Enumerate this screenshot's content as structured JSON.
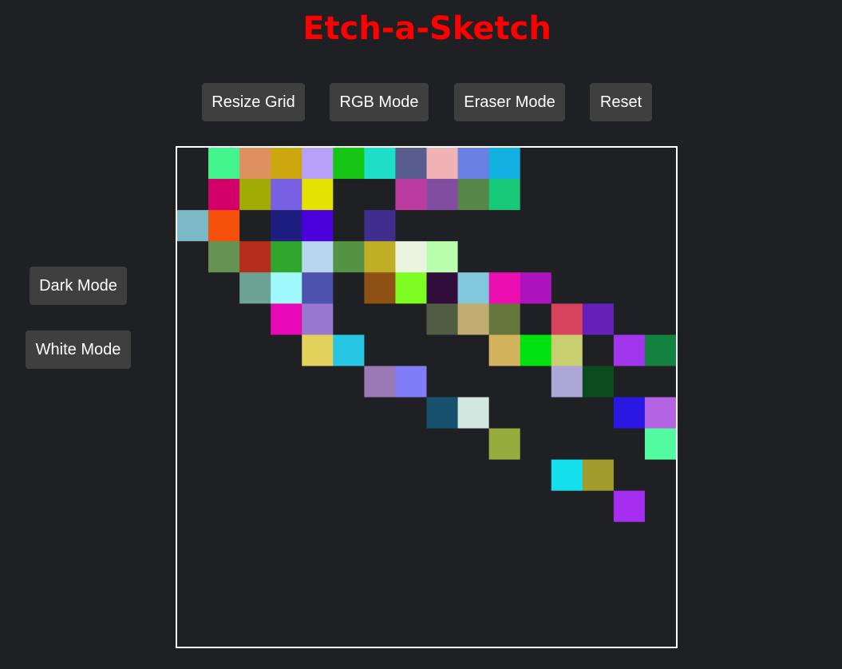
{
  "app": {
    "title": "Etch-a-Sketch",
    "title_color": "#ff0000",
    "background_color": "#1f2023"
  },
  "toolbar": {
    "resize_label": "Resize Grid",
    "rgb_label": "RGB Mode",
    "eraser_label": "Eraser Mode",
    "reset_label": "Reset"
  },
  "side_panel": {
    "dark_label": "Dark Mode",
    "white_label": "White Mode"
  },
  "grid": {
    "columns": 16,
    "rows": 16,
    "border_color": "#ffffff",
    "empty_color": "#1f2023",
    "painted_cells": [
      {
        "row": 0,
        "col": 1,
        "color": "#42f58d"
      },
      {
        "row": 0,
        "col": 2,
        "color": "#de9060"
      },
      {
        "row": 0,
        "col": 3,
        "color": "#cca70f"
      },
      {
        "row": 0,
        "col": 4,
        "color": "#b8a1fb"
      },
      {
        "row": 0,
        "col": 5,
        "color": "#15c614"
      },
      {
        "row": 0,
        "col": 6,
        "color": "#1ddec6"
      },
      {
        "row": 0,
        "col": 7,
        "color": "#595c8e"
      },
      {
        "row": 0,
        "col": 8,
        "color": "#f0b2b5"
      },
      {
        "row": 0,
        "col": 9,
        "color": "#6a80e2"
      },
      {
        "row": 0,
        "col": 10,
        "color": "#12b1e1"
      },
      {
        "row": 1,
        "col": 1,
        "color": "#d30069"
      },
      {
        "row": 1,
        "col": 2,
        "color": "#a0ab03"
      },
      {
        "row": 1,
        "col": 3,
        "color": "#7961e4"
      },
      {
        "row": 1,
        "col": 4,
        "color": "#e3e200"
      },
      {
        "row": 1,
        "col": 7,
        "color": "#bc3ba1"
      },
      {
        "row": 1,
        "col": 8,
        "color": "#814da1"
      },
      {
        "row": 1,
        "col": 9,
        "color": "#568748"
      },
      {
        "row": 1,
        "col": 10,
        "color": "#19c97a"
      },
      {
        "row": 2,
        "col": 0,
        "color": "#7ab9c5"
      },
      {
        "row": 2,
        "col": 1,
        "color": "#f5510a"
      },
      {
        "row": 2,
        "col": 3,
        "color": "#1d1e80"
      },
      {
        "row": 2,
        "col": 4,
        "color": "#4b00dc"
      },
      {
        "row": 2,
        "col": 6,
        "color": "#3f2e8d"
      },
      {
        "row": 3,
        "col": 1,
        "color": "#659352"
      },
      {
        "row": 3,
        "col": 2,
        "color": "#b72d1c"
      },
      {
        "row": 3,
        "col": 3,
        "color": "#2ea52b"
      },
      {
        "row": 3,
        "col": 4,
        "color": "#b6d5ef"
      },
      {
        "row": 3,
        "col": 5,
        "color": "#539343"
      },
      {
        "row": 3,
        "col": 6,
        "color": "#bfae26"
      },
      {
        "row": 3,
        "col": 7,
        "color": "#ebf4e0"
      },
      {
        "row": 3,
        "col": 8,
        "color": "#b9fead"
      },
      {
        "row": 4,
        "col": 2,
        "color": "#6ca394"
      },
      {
        "row": 4,
        "col": 3,
        "color": "#a0f9fd"
      },
      {
        "row": 4,
        "col": 4,
        "color": "#4d52ae"
      },
      {
        "row": 4,
        "col": 6,
        "color": "#8e5314"
      },
      {
        "row": 4,
        "col": 7,
        "color": "#7dfd21"
      },
      {
        "row": 4,
        "col": 8,
        "color": "#300d3b"
      },
      {
        "row": 4,
        "col": 9,
        "color": "#82c8dd"
      },
      {
        "row": 4,
        "col": 10,
        "color": "#eb0fb2"
      },
      {
        "row": 4,
        "col": 11,
        "color": "#ad12bf"
      },
      {
        "row": 5,
        "col": 3,
        "color": "#e709b6"
      },
      {
        "row": 5,
        "col": 4,
        "color": "#9878ce"
      },
      {
        "row": 5,
        "col": 8,
        "color": "#4f5c42"
      },
      {
        "row": 5,
        "col": 9,
        "color": "#c1ad71"
      },
      {
        "row": 5,
        "col": 10,
        "color": "#66773e"
      },
      {
        "row": 5,
        "col": 12,
        "color": "#d5435d"
      },
      {
        "row": 5,
        "col": 13,
        "color": "#6520b8"
      },
      {
        "row": 6,
        "col": 4,
        "color": "#e2d15a"
      },
      {
        "row": 6,
        "col": 5,
        "color": "#27c6e5"
      },
      {
        "row": 6,
        "col": 10,
        "color": "#d4b35f"
      },
      {
        "row": 6,
        "col": 11,
        "color": "#00e210"
      },
      {
        "row": 6,
        "col": 12,
        "color": "#c9cf6e"
      },
      {
        "row": 6,
        "col": 14,
        "color": "#a136ec"
      },
      {
        "row": 6,
        "col": 15,
        "color": "#138241"
      },
      {
        "row": 7,
        "col": 6,
        "color": "#9a78b4"
      },
      {
        "row": 7,
        "col": 7,
        "color": "#817cf7"
      },
      {
        "row": 7,
        "col": 12,
        "color": "#ada7d8"
      },
      {
        "row": 7,
        "col": 13,
        "color": "#0b4b1e"
      },
      {
        "row": 8,
        "col": 8,
        "color": "#16526e"
      },
      {
        "row": 8,
        "col": 9,
        "color": "#d1e7df"
      },
      {
        "row": 8,
        "col": 14,
        "color": "#2b17e3"
      },
      {
        "row": 8,
        "col": 15,
        "color": "#b464e3"
      },
      {
        "row": 9,
        "col": 10,
        "color": "#96ac3d"
      },
      {
        "row": 9,
        "col": 15,
        "color": "#53fba0"
      },
      {
        "row": 10,
        "col": 12,
        "color": "#14dfed"
      },
      {
        "row": 10,
        "col": 13,
        "color": "#a29c2e"
      },
      {
        "row": 11,
        "col": 14,
        "color": "#a52df0"
      }
    ]
  }
}
